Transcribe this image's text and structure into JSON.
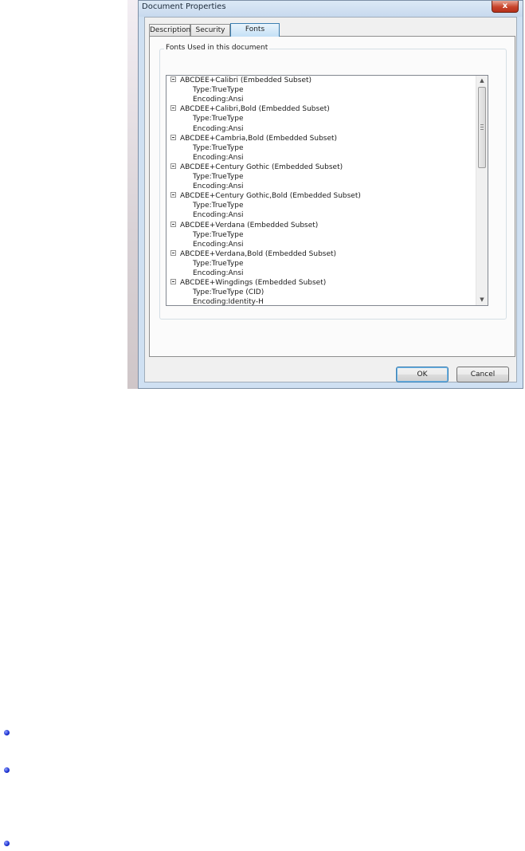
{
  "window": {
    "title": "Document Properties",
    "close_glyph": "x"
  },
  "tabs": [
    {
      "label": "Description",
      "active": false
    },
    {
      "label": "Security",
      "active": false
    },
    {
      "label": "Fonts",
      "active": true
    }
  ],
  "fonts_group": {
    "label": "Fonts Used in this document",
    "fonts": [
      {
        "name": "ABCDEE+Calibri (Embedded Subset)",
        "type": "Type:TrueType",
        "encoding": "Encoding:Ansi"
      },
      {
        "name": "ABCDEE+Calibri,Bold (Embedded Subset)",
        "type": "Type:TrueType",
        "encoding": "Encoding:Ansi"
      },
      {
        "name": "ABCDEE+Cambria,Bold (Embedded Subset)",
        "type": "Type:TrueType",
        "encoding": "Encoding:Ansi"
      },
      {
        "name": "ABCDEE+Century Gothic (Embedded Subset)",
        "type": "Type:TrueType",
        "encoding": "Encoding:Ansi"
      },
      {
        "name": "ABCDEE+Century Gothic,Bold (Embedded Subset)",
        "type": "Type:TrueType",
        "encoding": "Encoding:Ansi"
      },
      {
        "name": "ABCDEE+Verdana (Embedded Subset)",
        "type": "Type:TrueType",
        "encoding": "Encoding:Ansi"
      },
      {
        "name": "ABCDEE+Verdana,Bold (Embedded Subset)",
        "type": "Type:TrueType",
        "encoding": "Encoding:Ansi"
      },
      {
        "name": "ABCDEE+Wingdings (Embedded Subset)",
        "type": "Type:TrueType (CID)",
        "encoding": "Encoding:Identity-H"
      }
    ]
  },
  "scrollbar": {
    "up_glyph": "▲",
    "down_glyph": "▼"
  },
  "buttons": {
    "ok": "OK",
    "cancel": "Cancel"
  },
  "colors": {
    "bullet": "#1a2fcf",
    "dialog_frame": "#cfe0f2"
  }
}
